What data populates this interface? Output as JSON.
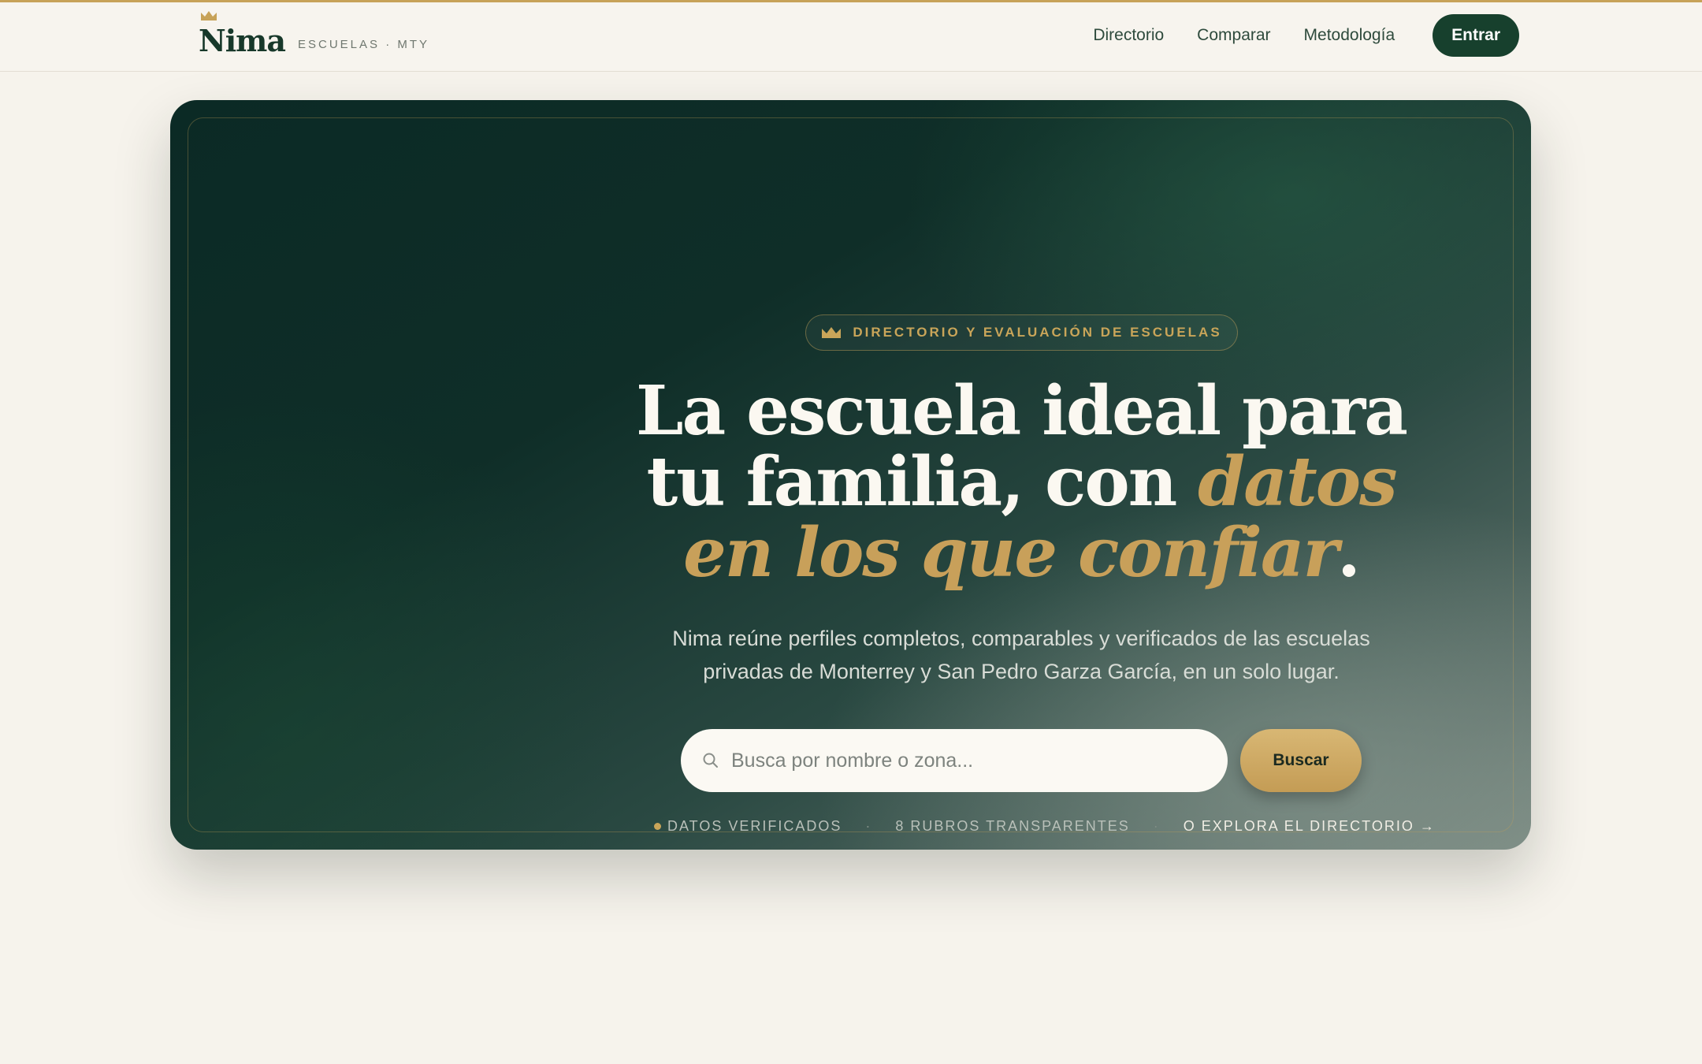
{
  "brand": {
    "name": "Nima",
    "subtitle": "ESCUELAS · MTY",
    "crown_icon": "crown-icon",
    "accent_color": "#c7a258",
    "primary_color": "#17402d"
  },
  "nav": {
    "items": [
      "Directorio",
      "Comparar",
      "Metodología"
    ],
    "cta_label": "Entrar"
  },
  "hero": {
    "badge": "DIRECTORIO Y EVALUACIÓN DE ESCUELAS",
    "headline_line1": "La escuela ideal para",
    "headline_line2_plain": "tu familia, con ",
    "headline_line2_gold": "datos",
    "headline_line3_gold": "en los que confiar",
    "headline_period": ".",
    "lead_line1": "Nima reúne perfiles completos, comparables y verificados de las escuelas",
    "lead_line2": "privadas de Monterrey y San Pedro Garza García, en un solo lugar.",
    "search": {
      "placeholder": "Busca por nombre o zona...",
      "value": "",
      "button_label": "Buscar"
    },
    "meta": {
      "item1": "DATOS VERIFICADOS",
      "separator": "·",
      "item2": "8 RUBROS TRANSPARENTES",
      "explore": "O EXPLORA EL DIRECTORIO →"
    }
  }
}
